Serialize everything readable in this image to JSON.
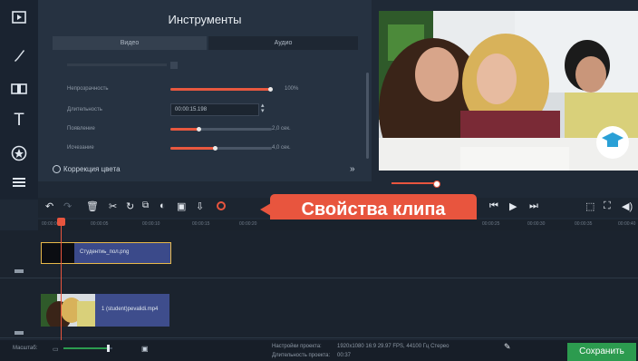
{
  "tools": {
    "title": "Инструменты",
    "tab_video": "Видео",
    "tab_audio": "Аудио",
    "rows": [
      {
        "label": "Непрозрачность",
        "value": "100%",
        "fill": 1.0
      },
      {
        "label": "Длительность",
        "value": "00:00:15.198",
        "fill": 0
      },
      {
        "label": "Появление",
        "value": "2,0 сек.",
        "fill": 0.28
      },
      {
        "label": "Исчезание",
        "value": "4,0 сек.",
        "fill": 0.45
      }
    ],
    "color_correction": "Коррекция цвета"
  },
  "callout": "Свойства клипа",
  "ruler": [
    "00:00:00",
    "00:00:05",
    "00:00:10",
    "00:00:15",
    "00:00:20",
    "00:00:25",
    "00:00:30",
    "00:00:35",
    "00:00:40"
  ],
  "clips": {
    "title_clip": "Студентиь_пол.png",
    "video_clip": "1 (student)pevalidi.mp4"
  },
  "status": {
    "scale_label": "Масштаб:",
    "project_settings_label": "Настройки проекта:",
    "project_settings_value": "1920x1080 16:9 29.97 FPS, 44100 Гц Стерео",
    "duration_label": "Длительность проекта:",
    "duration_value": "00:37"
  },
  "save_button": "Сохранить",
  "icons": [
    "media-icon",
    "brush-icon",
    "clip-icon",
    "text-icon",
    "sticker-icon",
    "menu-icon"
  ]
}
